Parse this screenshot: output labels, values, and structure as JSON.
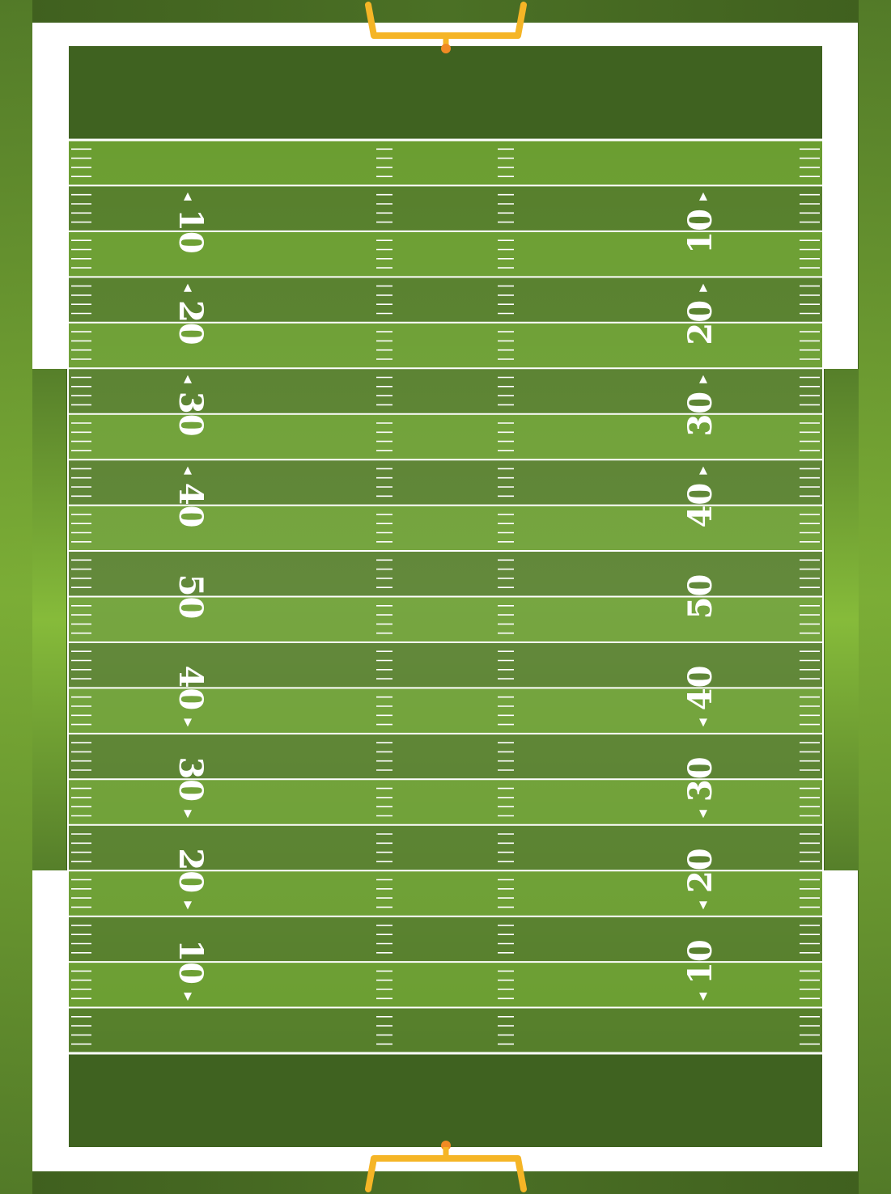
{
  "field": {
    "yard_numbers_left": [
      "10",
      "20",
      "30",
      "40",
      "50",
      "40",
      "30",
      "20",
      "10"
    ],
    "yard_numbers_right": [
      "10",
      "20",
      "30",
      "40",
      "50",
      "40",
      "30",
      "20",
      "10"
    ],
    "arrow_directions": [
      "up",
      "up",
      "up",
      "up",
      "none",
      "down",
      "down",
      "down",
      "down"
    ],
    "end_zones": [
      "top",
      "bottom"
    ],
    "goalposts": [
      "top",
      "bottom"
    ]
  },
  "colors": {
    "outer_grass": "#4a6e24",
    "sideline_glow": "#8ac03c",
    "boundary_white": "#ffffff",
    "endzone_green": "#3f6220",
    "stripe_dark": "#567f2b",
    "stripe_light": "#6b9e31",
    "line_white": "#ffffff",
    "goalpost_yellow": "#f5b526",
    "goalpost_orange": "#f08a24"
  }
}
